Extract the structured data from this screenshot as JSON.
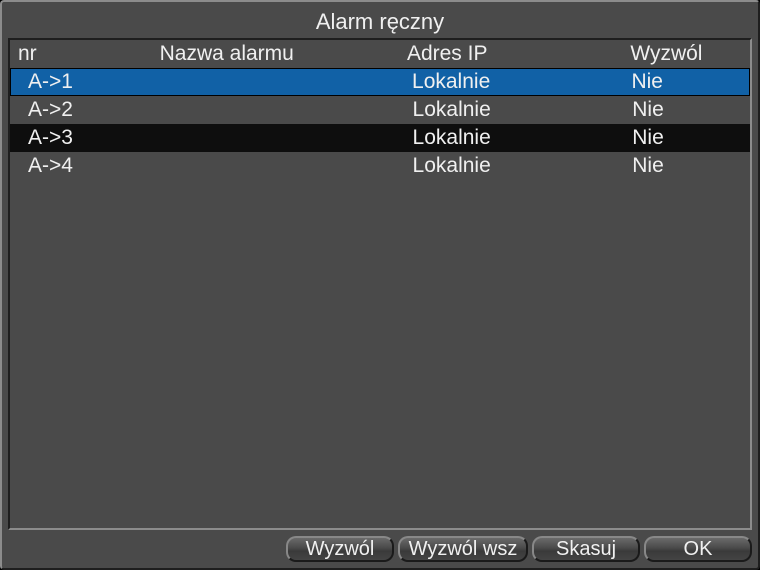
{
  "title": "Alarm ręczny",
  "columns": {
    "nr": "nr",
    "name": "Nazwa alarmu",
    "ip": "Adres IP",
    "trigger": "Wyzwól"
  },
  "rows": [
    {
      "nr": "A->1",
      "name": "",
      "ip": "Lokalnie",
      "trigger": "Nie",
      "style": "selected"
    },
    {
      "nr": "A->2",
      "name": "",
      "ip": "Lokalnie",
      "trigger": "Nie",
      "style": "odd"
    },
    {
      "nr": "A->3",
      "name": "",
      "ip": "Lokalnie",
      "trigger": "Nie",
      "style": "dark"
    },
    {
      "nr": "A->4",
      "name": "",
      "ip": "Lokalnie",
      "trigger": "Nie",
      "style": "odd"
    }
  ],
  "buttons": {
    "wyzwol": "Wyzwól",
    "wyzwol_wsz": "Wyzwól wsz",
    "skasuj": "Skasuj",
    "ok": "OK"
  }
}
